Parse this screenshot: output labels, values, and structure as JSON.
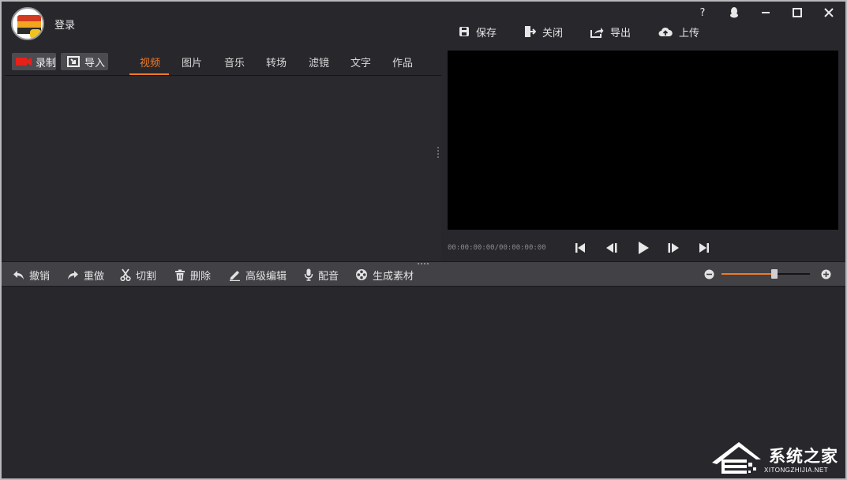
{
  "header": {
    "login_label": "登录"
  },
  "window_controls": {
    "help": "?"
  },
  "top_toolbar": {
    "save": "保存",
    "close": "关闭",
    "export": "导出",
    "upload": "上传"
  },
  "left_tabs": {
    "record": "录制",
    "import": "导入",
    "tabs": [
      "视频",
      "图片",
      "音乐",
      "转场",
      "滤镜",
      "文字",
      "作品"
    ],
    "active_tab": "视频"
  },
  "player": {
    "timecode": "00:00:00:00/00:00:00:00"
  },
  "edit_toolbar": {
    "undo": "撤销",
    "redo": "重做",
    "cut": "切割",
    "delete": "删除",
    "advanced_edit": "高级编辑",
    "dub": "配音",
    "generate_material": "生成素材"
  },
  "zoom": {
    "level": 0.6
  },
  "watermark": {
    "title": "系统之家",
    "url": "XITONGZHIJIA.NET"
  },
  "colors": {
    "accent": "#f07a25",
    "background": "#28272c",
    "toolbar": "#424146",
    "preview": "#000000",
    "record_icon": "#e8201a"
  }
}
